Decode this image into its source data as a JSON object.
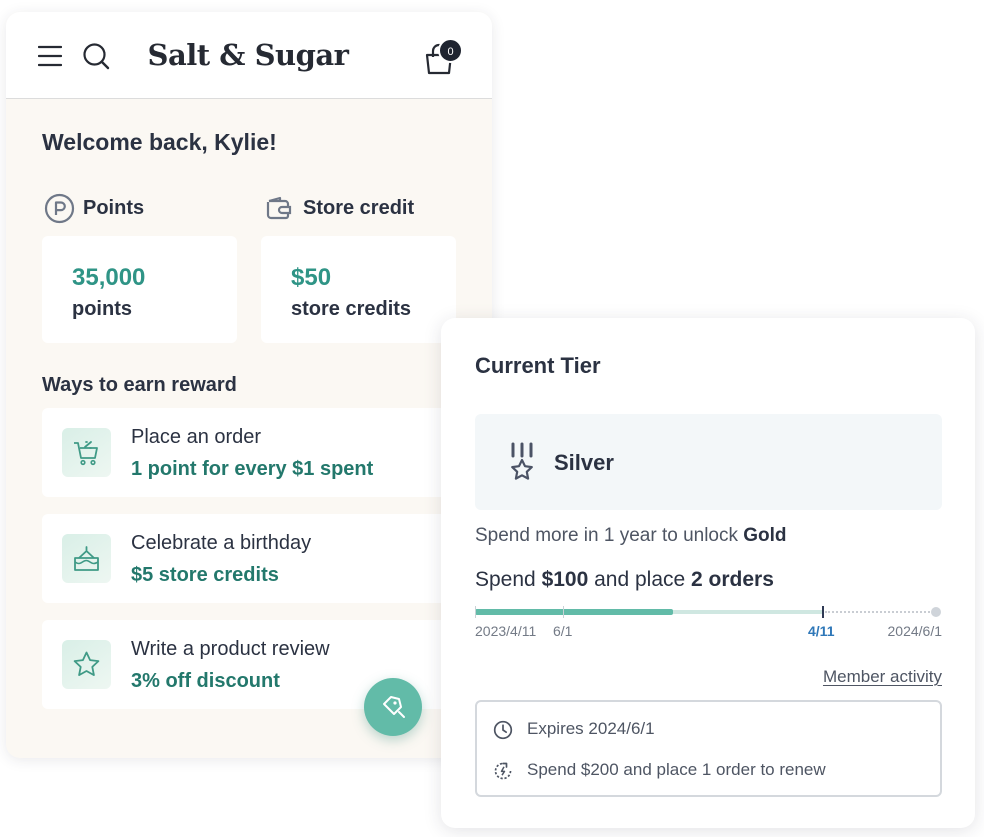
{
  "header": {
    "brand": "Salt & Sugar",
    "cart_count": "0"
  },
  "welcome": "Welcome back, Kylie!",
  "points": {
    "label": "Points",
    "value": "35,000",
    "unit": "points"
  },
  "store_credit": {
    "label": "Store credit",
    "value": "$50",
    "unit": "store credits"
  },
  "earn": {
    "title": "Ways to earn reward",
    "items": [
      {
        "name": "Place an order",
        "reward": "1 point for every $1 spent",
        "icon": "cart-icon"
      },
      {
        "name": "Celebrate a birthday",
        "reward": "$5 store credits",
        "icon": "cake-icon"
      },
      {
        "name": "Write a product review",
        "reward": "3% off discount",
        "icon": "star-icon"
      }
    ]
  },
  "tier": {
    "title": "Current Tier",
    "name": "Silver",
    "unlock_prefix": "Spend more in 1 year to unlock ",
    "unlock_tier": "Gold",
    "spend_prefix": "Spend ",
    "spend_amount": "$100",
    "spend_mid": " and place ",
    "spend_orders": "2 orders",
    "progress": {
      "fill_fraction": 0.425,
      "labels": {
        "start": "2023/4/11",
        "mid": "6/1",
        "today": "4/11",
        "end": "2024/6/1"
      }
    },
    "member_activity": "Member activity",
    "expires": "Expires 2024/6/1",
    "renew": "Spend $200 and place 1 order to renew"
  },
  "colors": {
    "accent": "#2f9486",
    "accent_dark": "#23786c",
    "progress_fill": "#62bba8",
    "today_marker": "#2e77b8",
    "panel_bg": "#fbf8f3"
  }
}
